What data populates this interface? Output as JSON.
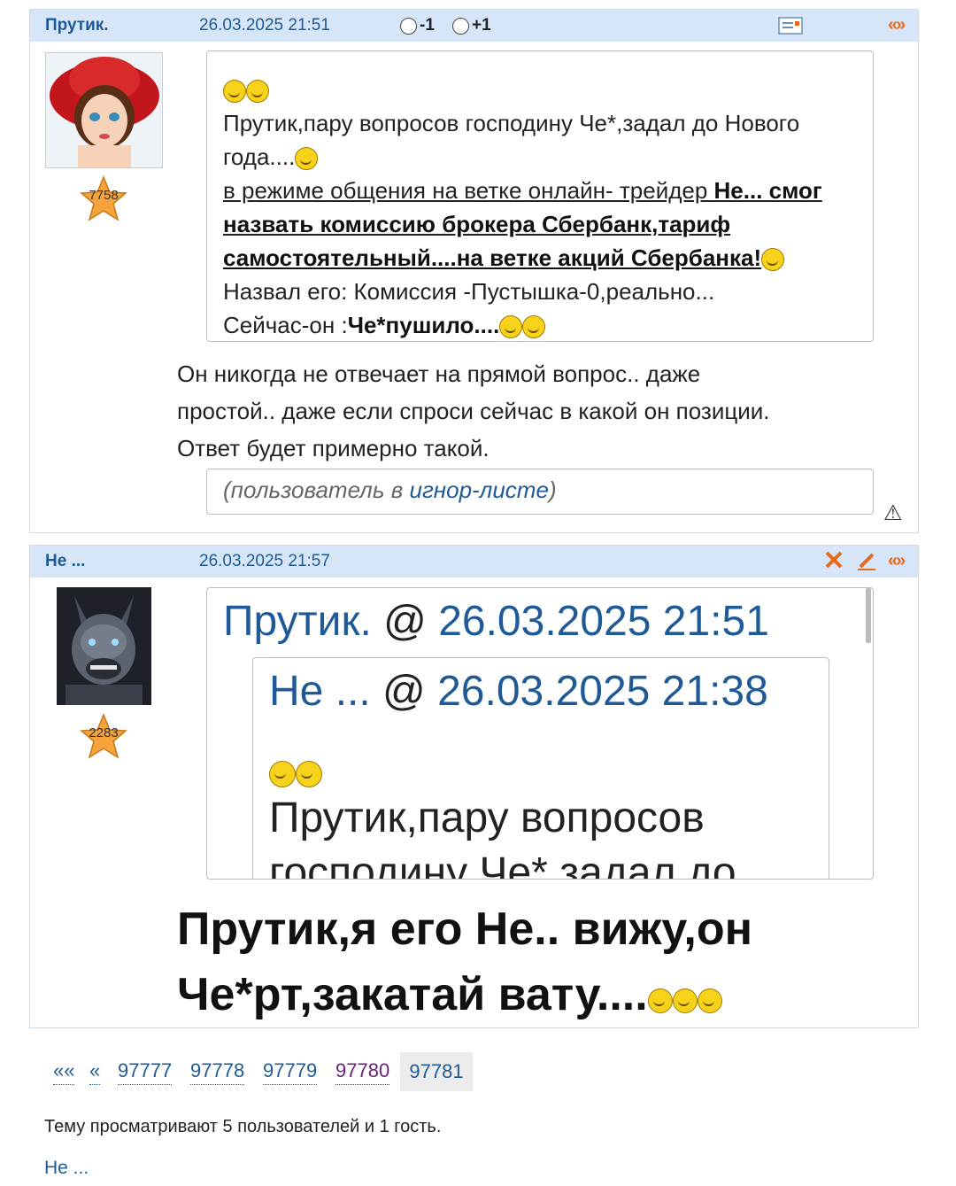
{
  "post1": {
    "author": "Прутик.",
    "date": "26.03.2025 21:51",
    "vote_minus": "-1",
    "vote_plus": "+1",
    "quote_nav": "«»",
    "rating": "7758",
    "quote_line1": "Прутик,пару вопросов господину Че*,задал до Нового",
    "quote_line2": "года....",
    "quote_link_plain": "в режиме общения на ветке онлайн- трейдер ",
    "quote_link_bold1": "Не... смог",
    "quote_link_bold2": "назвать комиссию брокера Сбербанк,тариф",
    "quote_link_bold3": "самостоятельный....на ветке акций Сбербанка!",
    "quote_line6": "Назвал его: Комиссия -Пустышка-0,реально...",
    "quote_line7_plain": "Сейчас-он :",
    "quote_line7_bold": "Че*пушило....",
    "body_line1": "Он никогда не отвечает на прямой вопрос.. даже",
    "body_line2": "простой.. даже если спроси сейчас в какой он позиции.",
    "body_line3": "Ответ будет примерно такой.",
    "ignored_prefix": "(пользователь в ",
    "ignored_link": "игнор-листе",
    "ignored_suffix": ")",
    "warn_icon": "⚠"
  },
  "post2": {
    "author": "Не ...",
    "date": "26.03.2025 21:57",
    "quote_nav": "«»",
    "rating": "2283",
    "quote_author": "Прутик.",
    "quote_at": " @ ",
    "quote_date": "26.03.2025 21:51",
    "inner_author": "Не ...",
    "inner_at": " @ ",
    "inner_date": "26.03.2025 21:38",
    "inner_line1": "Прутик,пару вопросов",
    "inner_line2": "господину Че*,задал до",
    "body_line1": "Прутик,я его Не.. вижу,он",
    "body_line2": "Че*рт,закатай вату...."
  },
  "pager": {
    "first": "««",
    "prev": "«",
    "pages": [
      "97777",
      "97778",
      "97779",
      "97780"
    ],
    "current": "97781"
  },
  "viewers_text": "Тему просматривают 5 пользователей и 1 гость.",
  "viewer_user": "Не ...",
  "colors": {
    "header_bg": "#d6e6f8",
    "link": "#1f5a96",
    "accent": "#e8681a",
    "visited": "#6b1f7a"
  }
}
